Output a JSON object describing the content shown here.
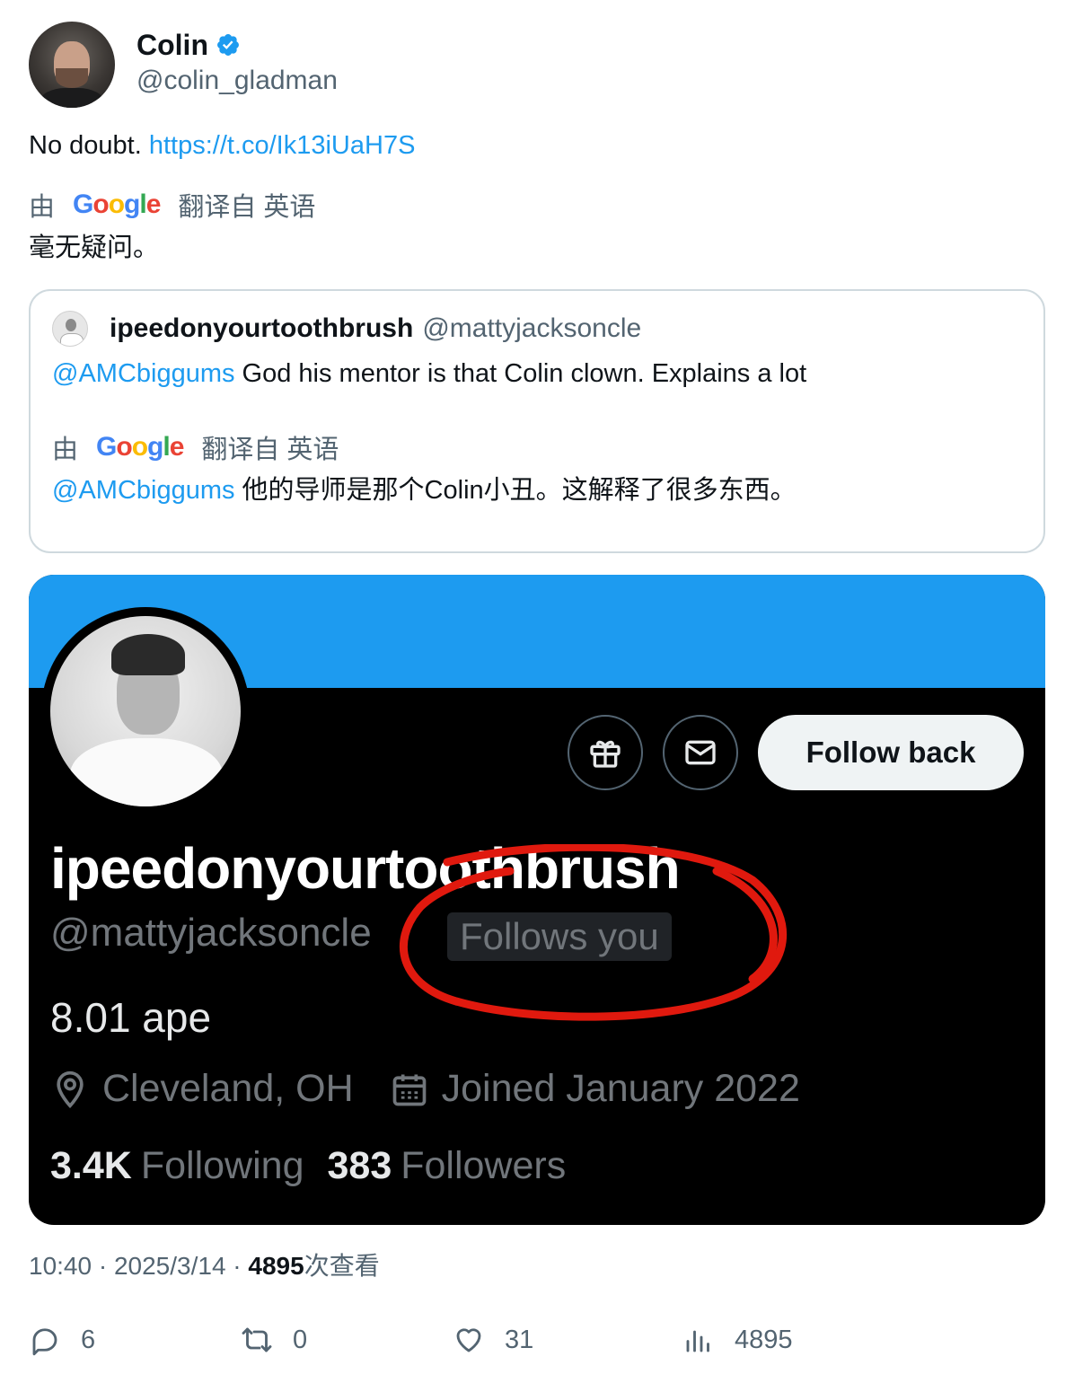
{
  "author": {
    "name": "Colin",
    "handle": "@colin_gladman",
    "verified": true
  },
  "tweet": {
    "text_plain": "No doubt. ",
    "link": "https://t.co/Ik13iUaH7S",
    "translate_by": "由",
    "translate_from": "翻译自 英语",
    "translation": "毫无疑问。"
  },
  "google_logo": {
    "g1": "G",
    "o1": "o",
    "o2": "o",
    "g2": "g",
    "l": "l",
    "e": "e"
  },
  "quote": {
    "name": "ipeedonyourtoothbrush",
    "handle": "@mattyjacksoncle",
    "mention": "@AMCbiggums",
    "text": " God his mentor is that Colin clown.  Explains a lot",
    "translate_by": "由",
    "translate_from": "翻译自 英语",
    "translation_mention": "@AMCbiggums",
    "translation": " 他的导师是那个Colin小丑。这解释了很多东西。"
  },
  "profile_card": {
    "name": "ipeedonyourtoothbrush",
    "handle": "@mattyjacksoncle",
    "follows_badge": "Follows you",
    "follow_button": "Follow back",
    "bio": "8.01 ape",
    "location": "Cleveland, OH",
    "joined": "Joined January 2022",
    "following_count": "3.4K",
    "following_label": "Following",
    "followers_count": "383",
    "followers_label": "Followers",
    "annotation_color": "#e0190e"
  },
  "meta": {
    "time": "10:40 · 2025/3/14 · ",
    "views_count": "4895",
    "views_label": "次查看"
  },
  "actions": {
    "replies": "6",
    "retweets": "0",
    "likes": "31",
    "views": "4895"
  },
  "colors": {
    "link": "#1d9bf0",
    "secondary_text": "#536471",
    "banner": "#1d9bf0"
  }
}
